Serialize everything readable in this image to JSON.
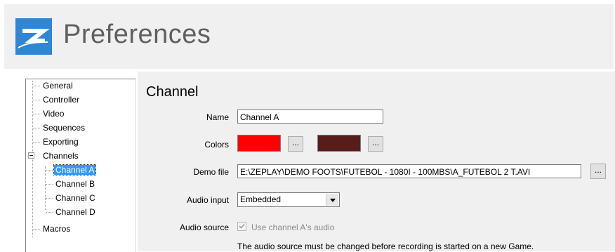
{
  "header": {
    "title": "Preferences",
    "logo_icon": "zeplay-logo-icon",
    "accent": "#2e86d4"
  },
  "tree": {
    "items": [
      {
        "label": "General"
      },
      {
        "label": "Controller"
      },
      {
        "label": "Video"
      },
      {
        "label": "Sequences"
      },
      {
        "label": "Exporting"
      },
      {
        "label": "Channels",
        "expanded": true
      },
      {
        "label": "Channel A",
        "selected": true
      },
      {
        "label": "Channel B"
      },
      {
        "label": "Channel C"
      },
      {
        "label": "Channel D"
      },
      {
        "label": "Macros"
      }
    ]
  },
  "panel": {
    "title": "Channel",
    "name_label": "Name",
    "name_value": "Channel A",
    "colors_label": "Colors",
    "color1": "#ff0000",
    "color2": "#561d1b",
    "browse_label": "...",
    "demo_label": "Demo file",
    "demo_value": "E:\\ZEPLAY\\DEMO FOOTS\\FUTEBOL - 1080I - 100MBS\\A_FUTEBOL 2 T.AVI",
    "audio_input_label": "Audio input",
    "audio_input_value": "Embedded",
    "audio_source_label": "Audio source",
    "audio_source_checkbox": "Use channel A's audio",
    "audio_source_checked": true,
    "note": "The audio source must be changed before recording is started on a new Game."
  }
}
